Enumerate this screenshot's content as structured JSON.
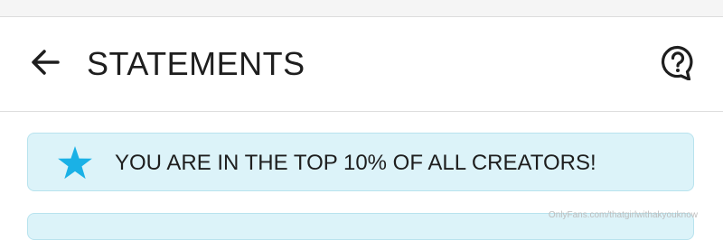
{
  "header": {
    "back_icon": "arrow-left-icon",
    "title": "STATEMENTS",
    "help_icon": "question-bubble-icon"
  },
  "banner": {
    "icon": "star-icon",
    "text": "YOU ARE IN THE TOP 10% OF ALL CREATORS!"
  },
  "watermark": "OnlyFans.com/thatgirlwithakyouknow",
  "colors": {
    "accent": "#1ab1e6",
    "banner_bg": "#dcf3f9",
    "banner_border": "#b8e3ee",
    "text": "#1e1e1e"
  }
}
